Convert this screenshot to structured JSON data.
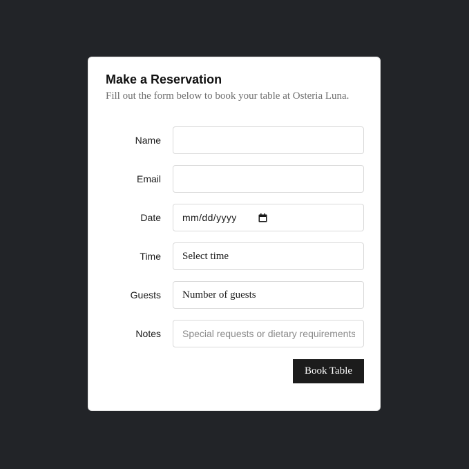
{
  "form": {
    "title": "Make a Reservation",
    "subtitle": "Fill out the form below to book your table at Osteria Luna.",
    "fields": [
      {
        "label": "Name",
        "value": "",
        "placeholder": ""
      },
      {
        "label": "Email",
        "value": "",
        "placeholder": ""
      },
      {
        "label": "Date",
        "value": "mm/dd/yyyy",
        "icon": "calendar-icon"
      },
      {
        "label": "Time",
        "value": "Select time"
      },
      {
        "label": "Guests",
        "value": "Number of guests"
      },
      {
        "label": "Notes",
        "value": "",
        "placeholder": "Special requests or dietary requirements"
      }
    ],
    "submit_label": "Book Table"
  },
  "colors": {
    "background": "#222428",
    "card": "#ffffff",
    "button": "#1c1c1c",
    "button_text": "#ffffff",
    "border": "#d9d9d9"
  }
}
